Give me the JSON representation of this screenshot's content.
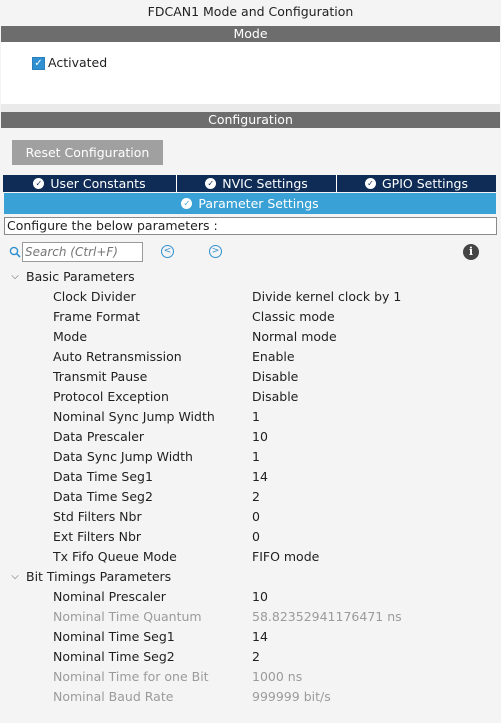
{
  "window": {
    "title": "FDCAN1 Mode and Configuration"
  },
  "mode_section": {
    "header": "Mode",
    "activated_label": "Activated",
    "activated_checked": true
  },
  "config_section": {
    "header": "Configuration",
    "reset_label": "Reset Configuration",
    "tabs": [
      {
        "label": "User Constants"
      },
      {
        "label": "NVIC Settings"
      },
      {
        "label": "GPIO Settings"
      }
    ],
    "active_tab": {
      "label": "Parameter Settings"
    },
    "instruction": "Configure the below parameters :",
    "search_placeholder": "Search (Ctrl+F)",
    "icons": {
      "search": "search-icon",
      "prev": "chevron-left-circle-icon",
      "next": "chevron-right-circle-icon",
      "info": "info-icon",
      "tab_check": "check-circle-icon"
    }
  },
  "groups": [
    {
      "label": "Basic Parameters",
      "params": [
        {
          "name": "Clock Divider",
          "value": "Divide kernel clock by 1",
          "enabled": true
        },
        {
          "name": "Frame Format",
          "value": "Classic mode",
          "enabled": true
        },
        {
          "name": "Mode",
          "value": "Normal mode",
          "enabled": true
        },
        {
          "name": "Auto Retransmission",
          "value": "Enable",
          "enabled": true
        },
        {
          "name": "Transmit Pause",
          "value": "Disable",
          "enabled": true
        },
        {
          "name": "Protocol Exception",
          "value": "Disable",
          "enabled": true
        },
        {
          "name": "Nominal Sync Jump Width",
          "value": "1",
          "enabled": true
        },
        {
          "name": "Data Prescaler",
          "value": "10",
          "enabled": true
        },
        {
          "name": "Data Sync Jump Width",
          "value": "1",
          "enabled": true
        },
        {
          "name": "Data Time Seg1",
          "value": "14",
          "enabled": true
        },
        {
          "name": "Data Time Seg2",
          "value": "2",
          "enabled": true
        },
        {
          "name": "Std Filters Nbr",
          "value": "0",
          "enabled": true
        },
        {
          "name": "Ext Filters Nbr",
          "value": "0",
          "enabled": true
        },
        {
          "name": "Tx Fifo Queue Mode",
          "value": "FIFO mode",
          "enabled": true
        }
      ]
    },
    {
      "label": "Bit Timings Parameters",
      "params": [
        {
          "name": "Nominal Prescaler",
          "value": "10",
          "enabled": true
        },
        {
          "name": "Nominal Time Quantum",
          "value": "58.82352941176471 ns",
          "enabled": false
        },
        {
          "name": "Nominal Time Seg1",
          "value": "14",
          "enabled": true
        },
        {
          "name": "Nominal Time Seg2",
          "value": "2",
          "enabled": true
        },
        {
          "name": "Nominal Time for one Bit",
          "value": "1000 ns",
          "enabled": false
        },
        {
          "name": "Nominal Baud Rate",
          "value": "999999 bit/s",
          "enabled": false
        }
      ]
    }
  ]
}
